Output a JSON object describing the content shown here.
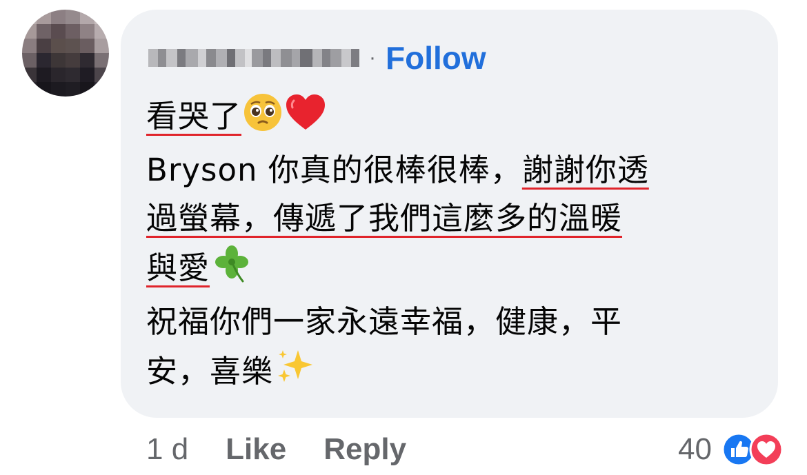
{
  "comment": {
    "follow_label": "Follow",
    "separator": "·",
    "lines": {
      "l1": "看哭了",
      "l2_plain": "Bryson 你真的很棒很棒，",
      "l2_underlined": "謝謝你透",
      "l3": "過螢幕，傳遞了我們這麼多的溫暖",
      "l4": "與愛",
      "l5": "祝福你們一家永遠幸福，健康，平",
      "l6": "安，喜樂"
    },
    "emojis": [
      "pleading-face",
      "red-heart",
      "four-leaf-clover",
      "sparkles"
    ]
  },
  "footer": {
    "timestamp": "1 d",
    "like_label": "Like",
    "reply_label": "Reply"
  },
  "reactions": {
    "count": "40",
    "types": [
      "like",
      "love"
    ]
  },
  "colors": {
    "link_blue": "#216fdb",
    "underline_red": "#e0242b",
    "bubble_bg": "#f0f2f5",
    "secondary_text": "#65676b",
    "primary_text": "#050505"
  }
}
